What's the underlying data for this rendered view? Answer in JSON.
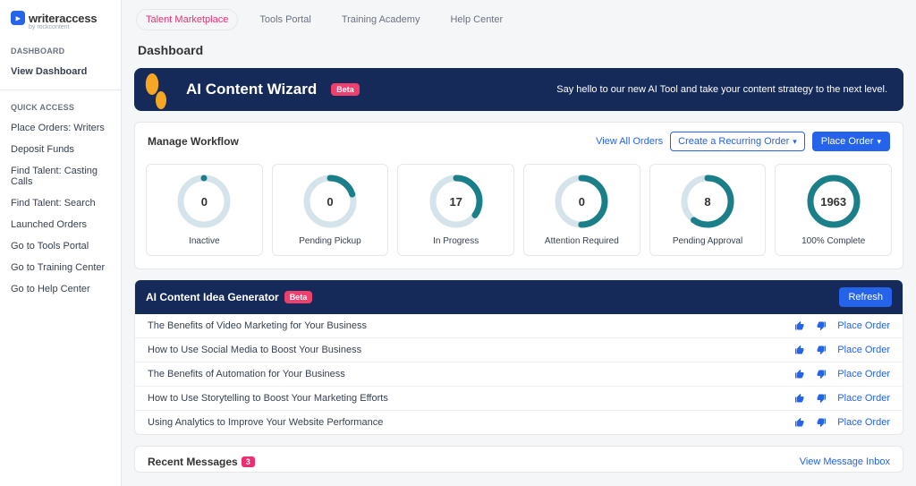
{
  "brand": {
    "name": "writeraccess",
    "by": "by rockcontent"
  },
  "nav": {
    "dashboard_head": "DASHBOARD",
    "view_dashboard": "View Dashboard",
    "quick_head": "QUICK ACCESS",
    "items": [
      "Place Orders: Writers",
      "Deposit Funds",
      "Find Talent: Casting Calls",
      "Find Talent: Search",
      "Launched Orders",
      "Go to Tools Portal",
      "Go to Training Center",
      "Go to Help Center"
    ]
  },
  "topTabs": [
    "Talent Marketplace",
    "Tools Portal",
    "Training Academy",
    "Help Center"
  ],
  "pageTitle": "Dashboard",
  "banner": {
    "title": "AI Content Wizard",
    "beta": "Beta",
    "sub": "Say hello to our new AI Tool and take your content strategy to the next level."
  },
  "workflow": {
    "title": "Manage Workflow",
    "viewAll": "View All Orders",
    "recurring": "Create a Recurring Order",
    "placeOrder": "Place Order",
    "items": [
      {
        "value": "0",
        "label": "Inactive",
        "pct": 0
      },
      {
        "value": "0",
        "label": "Pending Pickup",
        "pct": 20
      },
      {
        "value": "17",
        "label": "In Progress",
        "pct": 35
      },
      {
        "value": "0",
        "label": "Attention Required",
        "pct": 50
      },
      {
        "value": "8",
        "label": "Pending Approval",
        "pct": 60
      },
      {
        "value": "1963",
        "label": "100% Complete",
        "pct": 100
      }
    ]
  },
  "ideas": {
    "title": "AI Content Idea Generator",
    "beta": "Beta",
    "refresh": "Refresh",
    "placeOrder": "Place Order",
    "rows": [
      "The Benefits of Video Marketing for Your Business",
      "How to Use Social Media to Boost Your Business",
      "The Benefits of Automation for Your Business",
      "How to Use Storytelling to Boost Your Marketing Efforts",
      "Using Analytics to Improve Your Website Performance"
    ]
  },
  "messages": {
    "title": "Recent Messages",
    "count": "3",
    "inbox": "View Message Inbox"
  },
  "chart_data": {
    "type": "bar",
    "title": "Manage Workflow status counts",
    "categories": [
      "Inactive",
      "Pending Pickup",
      "In Progress",
      "Attention Required",
      "Pending Approval",
      "100% Complete"
    ],
    "values": [
      0,
      0,
      17,
      0,
      8,
      1963
    ],
    "ring_fill_pct": [
      0,
      20,
      35,
      50,
      60,
      100
    ]
  }
}
